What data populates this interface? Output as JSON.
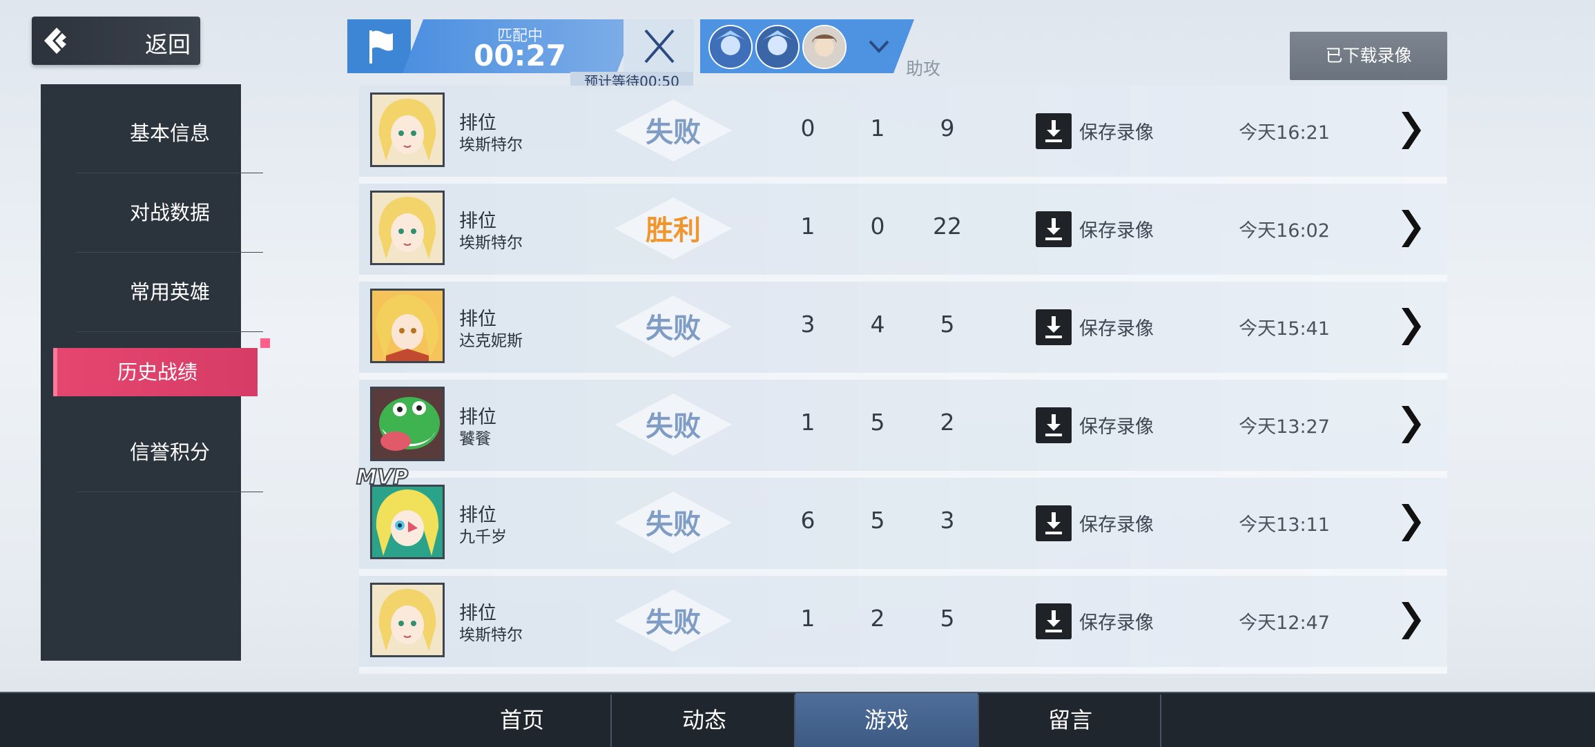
{
  "back": {
    "label": "返回"
  },
  "sidebar": {
    "items": [
      {
        "label": "基本信息"
      },
      {
        "label": "对战数据"
      },
      {
        "label": "常用英雄"
      },
      {
        "label": "历史战绩"
      },
      {
        "label": "信誉积分"
      }
    ],
    "active_index": 3
  },
  "matchmaking": {
    "status": "匹配中",
    "elapsed": "00:27",
    "estimate": "预计等待00:50"
  },
  "header": {
    "downloaded_button": "已下载录像",
    "column_assist": "助攻"
  },
  "rows": [
    {
      "mode": "排位",
      "hero": "埃斯特尔",
      "result": "失败",
      "kills": "0",
      "deaths": "1",
      "assists": "9",
      "save_label": "保存录像",
      "time": "今天16:21",
      "mvp": ""
    },
    {
      "mode": "排位",
      "hero": "埃斯特尔",
      "result": "胜利",
      "kills": "1",
      "deaths": "0",
      "assists": "22",
      "save_label": "保存录像",
      "time": "今天16:02",
      "mvp": ""
    },
    {
      "mode": "排位",
      "hero": "达克妮斯",
      "result": "失败",
      "kills": "3",
      "deaths": "4",
      "assists": "5",
      "save_label": "保存录像",
      "time": "今天15:41",
      "mvp": ""
    },
    {
      "mode": "排位",
      "hero": "饕餮",
      "result": "失败",
      "kills": "1",
      "deaths": "5",
      "assists": "2",
      "save_label": "保存录像",
      "time": "今天13:27",
      "mvp": ""
    },
    {
      "mode": "排位",
      "hero": "九千岁",
      "result": "失败",
      "kills": "6",
      "deaths": "5",
      "assists": "3",
      "save_label": "保存录像",
      "time": "今天13:11",
      "mvp": "MVP"
    },
    {
      "mode": "排位",
      "hero": "埃斯特尔",
      "result": "失败",
      "kills": "1",
      "deaths": "2",
      "assists": "5",
      "save_label": "保存录像",
      "time": "今天12:47",
      "mvp": ""
    }
  ],
  "colors": {
    "win": "#f0962f",
    "loss": "#7f9cc4",
    "active_tab": "#e5466f",
    "accent_blue": "#4b8fe0"
  },
  "bottom_nav": {
    "tabs": [
      {
        "label": "首页"
      },
      {
        "label": "动态"
      },
      {
        "label": "游戏"
      },
      {
        "label": "留言"
      }
    ],
    "active_index": 2
  }
}
